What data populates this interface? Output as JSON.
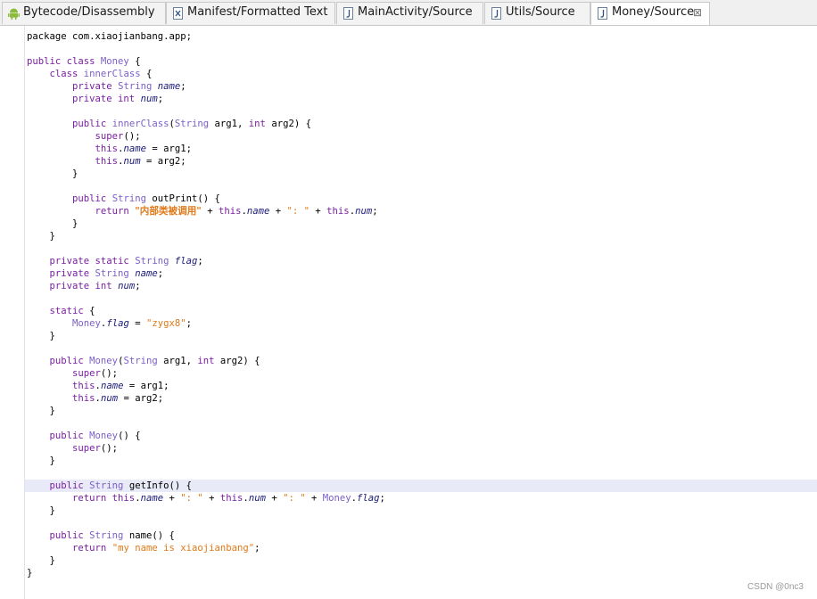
{
  "tabs": [
    {
      "label": "Bytecode/Disassembly",
      "icon": "android-icon",
      "active": false
    },
    {
      "label": "Manifest/Formatted Text",
      "icon": "xml-file-icon",
      "active": false
    },
    {
      "label": "MainActivity/Source",
      "icon": "java-file-icon",
      "active": false
    },
    {
      "label": "Utils/Source",
      "icon": "java-file-icon",
      "active": false
    },
    {
      "label": "Money/Source",
      "icon": "java-file-icon",
      "active": true,
      "close": "⊠"
    }
  ],
  "code": {
    "current_line": 36,
    "lines": [
      [
        [
          "plain",
          "package com.xiaojianbang.app;"
        ]
      ],
      [],
      [
        [
          "kw",
          "public class "
        ],
        [
          "ty",
          "Money"
        ],
        [
          "plain",
          " {"
        ]
      ],
      [
        [
          "plain",
          "    "
        ],
        [
          "kw",
          "class "
        ],
        [
          "ty",
          "innerClass"
        ],
        [
          "plain",
          " {"
        ]
      ],
      [
        [
          "plain",
          "        "
        ],
        [
          "kw",
          "private "
        ],
        [
          "ty",
          "String "
        ],
        [
          "fld",
          "name"
        ],
        [
          "plain",
          ";"
        ]
      ],
      [
        [
          "plain",
          "        "
        ],
        [
          "kw",
          "private int "
        ],
        [
          "fld",
          "num"
        ],
        [
          "plain",
          ";"
        ]
      ],
      [],
      [
        [
          "plain",
          "        "
        ],
        [
          "kw",
          "public "
        ],
        [
          "ty",
          "innerClass"
        ],
        [
          "plain",
          "("
        ],
        [
          "ty",
          "String"
        ],
        [
          "plain",
          " arg1, "
        ],
        [
          "kw",
          "int"
        ],
        [
          "plain",
          " arg2) {"
        ]
      ],
      [
        [
          "plain",
          "            "
        ],
        [
          "kw",
          "super"
        ],
        [
          "plain",
          "();"
        ]
      ],
      [
        [
          "plain",
          "            "
        ],
        [
          "kw",
          "this"
        ],
        [
          "plain",
          "."
        ],
        [
          "fld",
          "name"
        ],
        [
          "plain",
          " = arg1;"
        ]
      ],
      [
        [
          "plain",
          "            "
        ],
        [
          "kw",
          "this"
        ],
        [
          "plain",
          "."
        ],
        [
          "fld",
          "num"
        ],
        [
          "plain",
          " = arg2;"
        ]
      ],
      [
        [
          "plain",
          "        }"
        ]
      ],
      [],
      [
        [
          "plain",
          "        "
        ],
        [
          "kw",
          "public "
        ],
        [
          "ty",
          "String "
        ],
        [
          "plain",
          "outPrint() {"
        ]
      ],
      [
        [
          "plain",
          "            "
        ],
        [
          "kw",
          "return "
        ],
        [
          "str-zh",
          "\"内部类被调用\""
        ],
        [
          "plain",
          " + "
        ],
        [
          "kw",
          "this"
        ],
        [
          "plain",
          "."
        ],
        [
          "fld",
          "name"
        ],
        [
          "plain",
          " + "
        ],
        [
          "str",
          "\": \""
        ],
        [
          "plain",
          " + "
        ],
        [
          "kw",
          "this"
        ],
        [
          "plain",
          "."
        ],
        [
          "fld",
          "num"
        ],
        [
          "plain",
          ";"
        ]
      ],
      [
        [
          "plain",
          "        }"
        ]
      ],
      [
        [
          "plain",
          "    }"
        ]
      ],
      [],
      [
        [
          "plain",
          "    "
        ],
        [
          "kw",
          "private static "
        ],
        [
          "ty",
          "String "
        ],
        [
          "fld",
          "flag"
        ],
        [
          "plain",
          ";"
        ]
      ],
      [
        [
          "plain",
          "    "
        ],
        [
          "kw",
          "private "
        ],
        [
          "ty",
          "String "
        ],
        [
          "fld",
          "name"
        ],
        [
          "plain",
          ";"
        ]
      ],
      [
        [
          "plain",
          "    "
        ],
        [
          "kw",
          "private int "
        ],
        [
          "fld",
          "num"
        ],
        [
          "plain",
          ";"
        ]
      ],
      [],
      [
        [
          "plain",
          "    "
        ],
        [
          "kw",
          "static"
        ],
        [
          "plain",
          " {"
        ]
      ],
      [
        [
          "plain",
          "        "
        ],
        [
          "ty",
          "Money"
        ],
        [
          "plain",
          "."
        ],
        [
          "fld",
          "flag"
        ],
        [
          "plain",
          " = "
        ],
        [
          "str",
          "\"zygx8\""
        ],
        [
          "plain",
          ";"
        ]
      ],
      [
        [
          "plain",
          "    }"
        ]
      ],
      [],
      [
        [
          "plain",
          "    "
        ],
        [
          "kw",
          "public "
        ],
        [
          "ty",
          "Money"
        ],
        [
          "plain",
          "("
        ],
        [
          "ty",
          "String"
        ],
        [
          "plain",
          " arg1, "
        ],
        [
          "kw",
          "int"
        ],
        [
          "plain",
          " arg2) {"
        ]
      ],
      [
        [
          "plain",
          "        "
        ],
        [
          "kw",
          "super"
        ],
        [
          "plain",
          "();"
        ]
      ],
      [
        [
          "plain",
          "        "
        ],
        [
          "kw",
          "this"
        ],
        [
          "plain",
          "."
        ],
        [
          "fld",
          "name"
        ],
        [
          "plain",
          " = arg1;"
        ]
      ],
      [
        [
          "plain",
          "        "
        ],
        [
          "kw",
          "this"
        ],
        [
          "plain",
          "."
        ],
        [
          "fld",
          "num"
        ],
        [
          "plain",
          " = arg2;"
        ]
      ],
      [
        [
          "plain",
          "    }"
        ]
      ],
      [],
      [
        [
          "plain",
          "    "
        ],
        [
          "kw",
          "public "
        ],
        [
          "ty",
          "Money"
        ],
        [
          "plain",
          "() {"
        ]
      ],
      [
        [
          "plain",
          "        "
        ],
        [
          "kw",
          "super"
        ],
        [
          "plain",
          "();"
        ]
      ],
      [
        [
          "plain",
          "    }"
        ]
      ],
      [],
      [
        [
          "plain",
          "    "
        ],
        [
          "kw",
          "public "
        ],
        [
          "ty",
          "String "
        ],
        [
          "plain",
          "getInfo() {"
        ]
      ],
      [
        [
          "plain",
          "        "
        ],
        [
          "kw",
          "return this"
        ],
        [
          "plain",
          "."
        ],
        [
          "fld",
          "name"
        ],
        [
          "plain",
          " + "
        ],
        [
          "str",
          "\": \""
        ],
        [
          "plain",
          " + "
        ],
        [
          "kw",
          "this"
        ],
        [
          "plain",
          "."
        ],
        [
          "fld",
          "num"
        ],
        [
          "plain",
          " + "
        ],
        [
          "str",
          "\": \""
        ],
        [
          "plain",
          " + "
        ],
        [
          "ty",
          "Money"
        ],
        [
          "plain",
          "."
        ],
        [
          "fld",
          "flag"
        ],
        [
          "plain",
          ";"
        ]
      ],
      [
        [
          "plain",
          "    }"
        ]
      ],
      [],
      [
        [
          "plain",
          "    "
        ],
        [
          "kw",
          "public "
        ],
        [
          "ty",
          "String "
        ],
        [
          "plain",
          "name() {"
        ]
      ],
      [
        [
          "plain",
          "        "
        ],
        [
          "kw",
          "return "
        ],
        [
          "str",
          "\"my name is xiaojianbang\""
        ],
        [
          "plain",
          ";"
        ]
      ],
      [
        [
          "plain",
          "    }"
        ]
      ],
      [
        [
          "plain",
          "}"
        ]
      ]
    ]
  },
  "watermark": "CSDN @0nc3"
}
